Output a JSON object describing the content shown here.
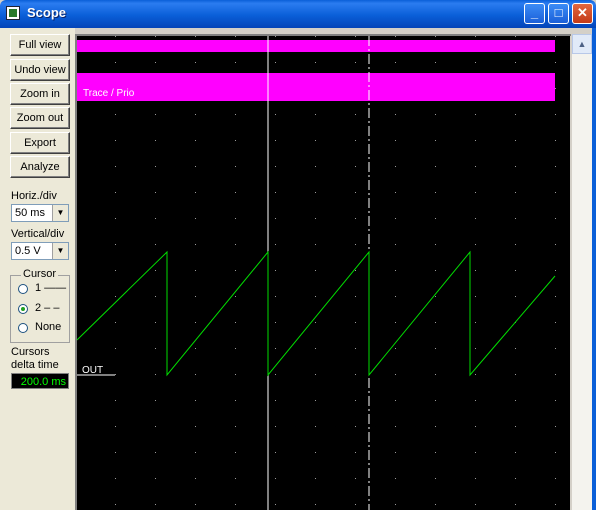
{
  "window": {
    "title": "Scope",
    "minimize_glyph": "_",
    "maximize_glyph": "□",
    "close_glyph": "✕"
  },
  "toolbar": {
    "full_view": "Full view",
    "undo_view": "Undo view",
    "zoom_in": "Zoom in",
    "zoom_out": "Zoom out",
    "export": "Export",
    "analyze": "Analyze"
  },
  "horiz": {
    "label": "Horiz./div",
    "value": "50 ms"
  },
  "vert": {
    "label": "Vertical/div",
    "value": "0.5 V"
  },
  "cursor": {
    "group_label": "Cursor",
    "opt1": "1 ——",
    "opt2": "2 – –",
    "opt3": "None",
    "selected": "2"
  },
  "cursors_delta": {
    "label_line1": "Cursors",
    "label_line2": "delta time",
    "value": "200.0 ms"
  },
  "trace": {
    "prio_label": "Trace / Prio",
    "signal_label": "OUT"
  },
  "colors": {
    "trace_bar": "#ff00ff",
    "signal": "#00dd00",
    "grid_dot": "#9a9a9a",
    "background": "#000000",
    "cursor_line": "#ffffff"
  },
  "scroll_up_glyph": "▲"
}
